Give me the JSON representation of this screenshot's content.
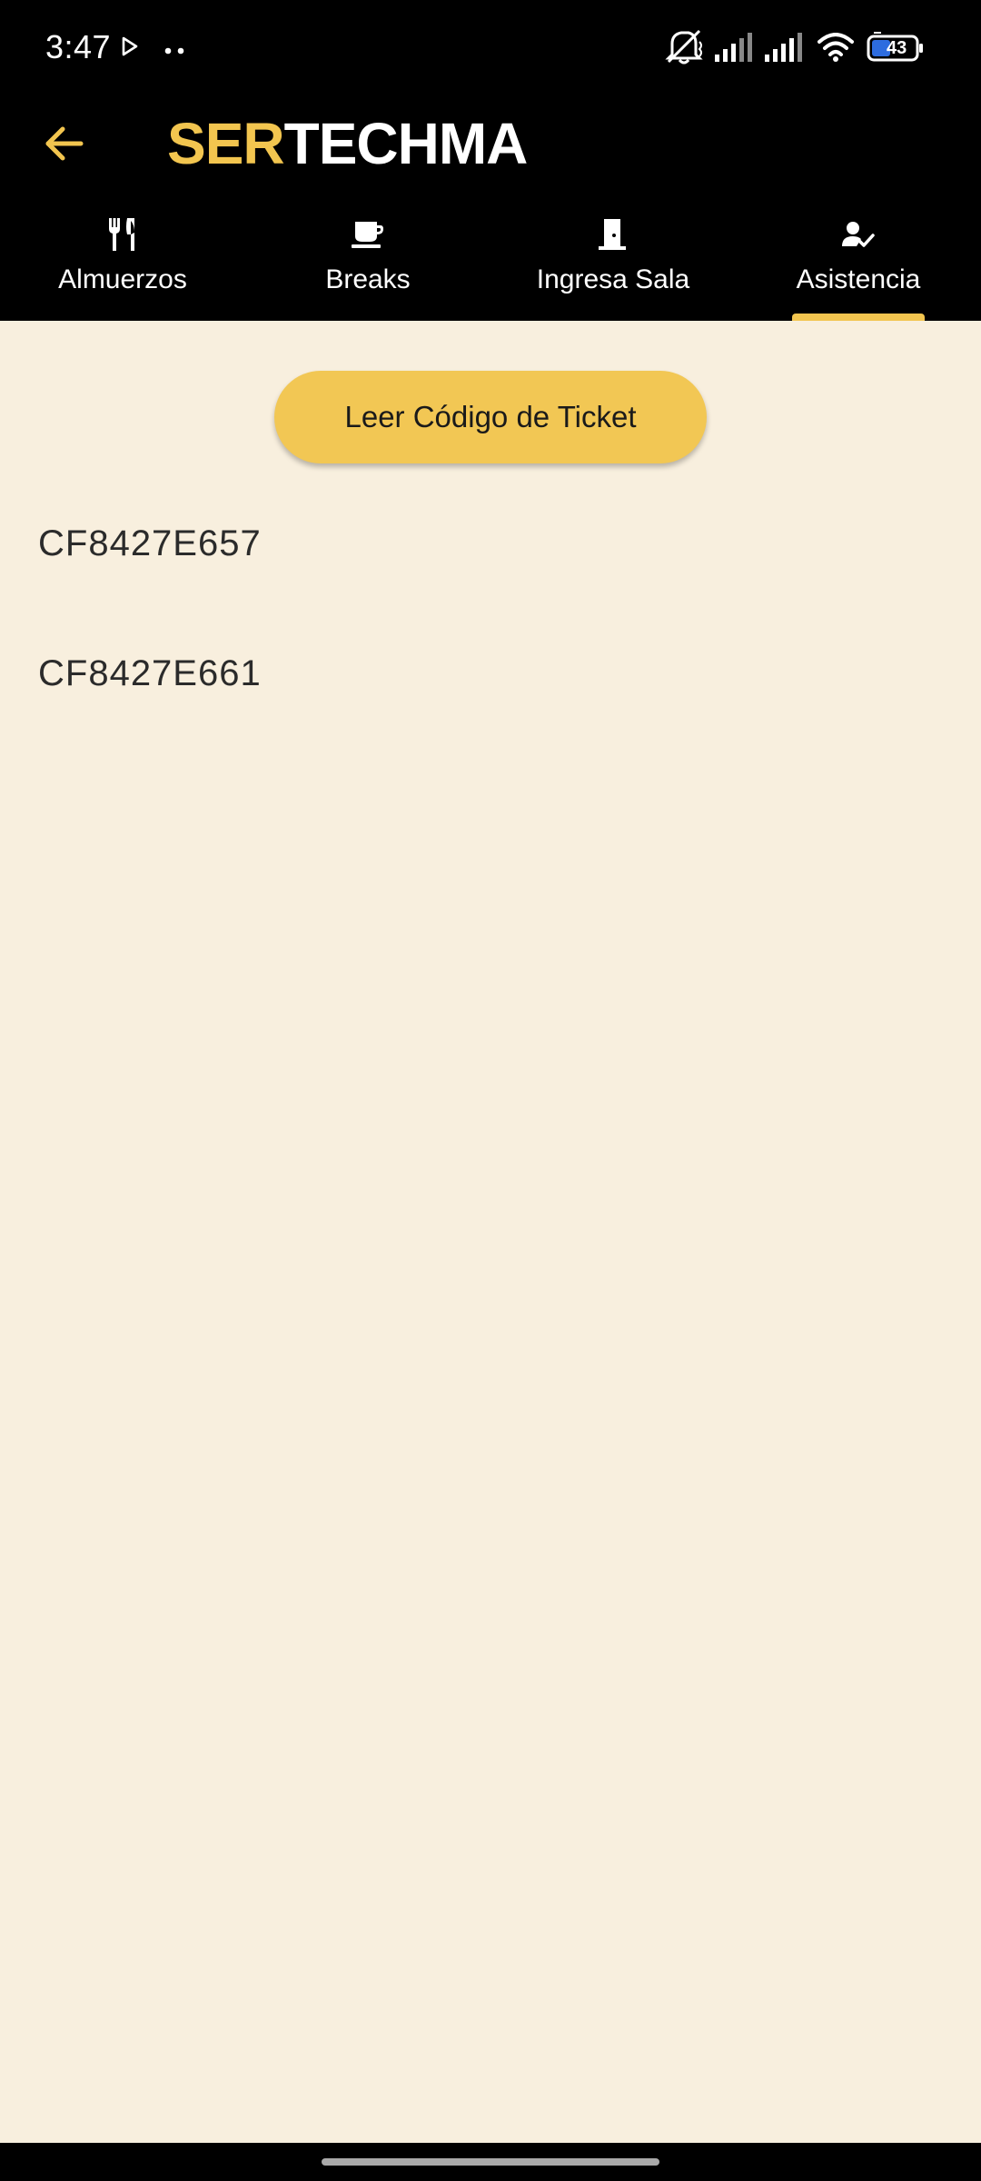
{
  "status": {
    "time": "3:47",
    "battery": "43",
    "icons": [
      "play-store-icon",
      "more-dots-icon",
      "mute-icon",
      "signal-icon",
      "signal-icon",
      "wifi-icon",
      "battery-icon"
    ]
  },
  "appbar": {
    "brand_accent": "SER",
    "brand_rest": "TECHMA",
    "back_icon": "arrow-back-icon",
    "accent_color": "#f2c54f"
  },
  "tabs": [
    {
      "label": "Almuerzos",
      "icon": "utensils-icon",
      "selected": false
    },
    {
      "label": "Breaks",
      "icon": "coffee-cup-icon",
      "selected": false
    },
    {
      "label": "Ingresa Sala",
      "icon": "door-icon",
      "selected": false
    },
    {
      "label": "Asistencia",
      "icon": "person-check-icon",
      "selected": true
    }
  ],
  "main": {
    "read_button_label": "Leer Código de Ticket",
    "codes": [
      "CF8427E657",
      "CF8427E661"
    ]
  }
}
